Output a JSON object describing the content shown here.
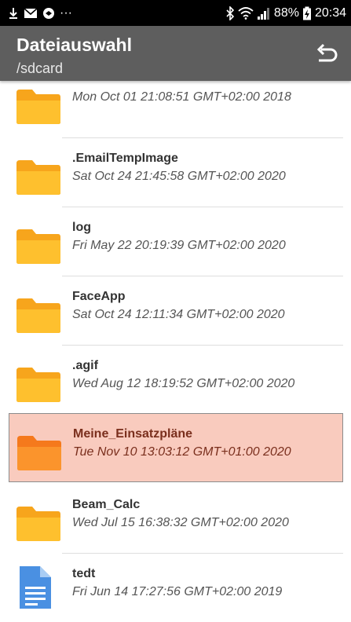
{
  "statusbar": {
    "notification_dots": "···",
    "battery": "88%",
    "time": "20:34"
  },
  "appbar": {
    "title": "Dateiauswahl",
    "path": "/sdcard"
  },
  "colors": {
    "appbar": "#5e5e5e",
    "folder": "#fdb92a",
    "selected_bg": "#f9cbbe",
    "file_icon": "#4a90e2"
  },
  "items": [
    {
      "name": "",
      "date": "Mon Oct 01 21:08:51 GMT+02:00 2018",
      "icon": "folder-icon"
    },
    {
      "name": ".EmailTempImage",
      "date": "Sat Oct 24 21:45:58 GMT+02:00 2020",
      "icon": "folder-icon"
    },
    {
      "name": "log",
      "date": "Fri May 22 20:19:39 GMT+02:00 2020",
      "icon": "folder-icon"
    },
    {
      "name": "FaceApp",
      "date": "Sat Oct 24 12:11:34 GMT+02:00 2020",
      "icon": "folder-icon"
    },
    {
      "name": ".agif",
      "date": "Wed Aug 12 18:19:52 GMT+02:00 2020",
      "icon": "folder-icon"
    },
    {
      "name": "Meine_Einsatzpläne",
      "date": "Tue Nov 10 13:03:12 GMT+01:00 2020",
      "icon": "folder-icon",
      "selected": true
    },
    {
      "name": "Beam_Calc",
      "date": "Wed Jul 15 16:38:32 GMT+02:00 2020",
      "icon": "folder-icon"
    },
    {
      "name": "tedt",
      "date": "Fri Jun 14 17:27:56 GMT+02:00 2019",
      "icon": "document-icon"
    }
  ]
}
